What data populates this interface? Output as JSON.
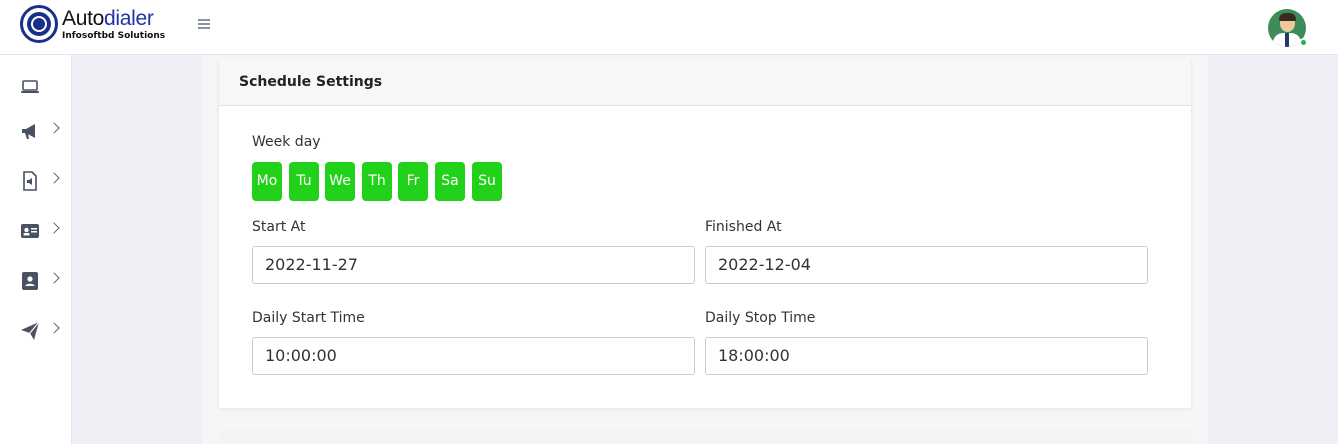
{
  "header": {
    "logo_word_main": "Auto",
    "logo_word_highlight": "dialer",
    "logo_subtitle": "Infosoftbd Solutions"
  },
  "sidebar": {
    "items": [
      {
        "icon": "laptop-icon"
      },
      {
        "icon": "megaphone-icon"
      },
      {
        "icon": "audio-file-icon"
      },
      {
        "icon": "id-card-icon"
      },
      {
        "icon": "contact-book-icon"
      },
      {
        "icon": "paper-plane-icon"
      }
    ]
  },
  "card": {
    "title": "Schedule Settings",
    "week_day_label": "Week day",
    "days": [
      "Mo",
      "Tu",
      "We",
      "Th",
      "Fr",
      "Sa",
      "Su"
    ],
    "day_active_color": "#22d11a",
    "start_at_label": "Start At",
    "start_at_value": "2022-11-27",
    "finished_at_label": "Finished At",
    "finished_at_value": "2022-12-04",
    "daily_start_label": "Daily Start Time",
    "daily_start_value": "10:00:00",
    "daily_stop_label": "Daily Stop Time",
    "daily_stop_value": "18:00:00"
  }
}
